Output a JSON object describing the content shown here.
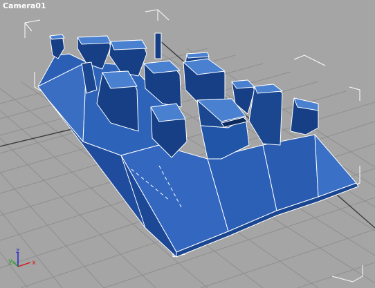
{
  "viewport": {
    "label": "Camera01",
    "background": "#a5a5a5"
  },
  "axis_tripod": {
    "x_label": "x",
    "y_label": "y",
    "z_label": "z",
    "x_color": "#d42020",
    "y_color": "#20a020",
    "z_color": "#2020d0"
  },
  "model": {
    "face_color": "#2b5fb5",
    "shadow_color": "#153a82",
    "edge_color": "#ffffff",
    "selected": true
  }
}
